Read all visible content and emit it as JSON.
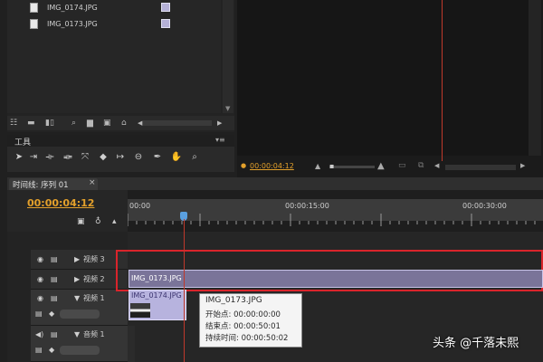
{
  "project": {
    "files": [
      {
        "name": "IMG_0174.JPG",
        "icon": "image-file-icon"
      },
      {
        "name": "IMG_0173.JPG",
        "icon": "image-file-icon"
      }
    ],
    "swatch_color": "#b5b1d7",
    "bottom_icons": [
      "list-view-icon",
      "icon-view-icon",
      "zoom-icon",
      "search-icon",
      "folder-icon",
      "new-item-icon",
      "delete-icon"
    ]
  },
  "tools": {
    "title": "工具",
    "items": [
      "selection-tool-icon",
      "track-select-icon",
      "ripple-edit-icon",
      "rolling-edit-icon",
      "rate-stretch-icon",
      "razor-icon",
      "slip-icon",
      "slide-icon",
      "pen-icon",
      "hand-icon",
      "zoom-tool-icon"
    ]
  },
  "monitor": {
    "timecode": "00:00:04:12"
  },
  "timeline": {
    "tab_label": "时间线: 序列 01",
    "tab_close": "×",
    "timecode": "00:00:04:12",
    "ruler_labels": [
      "00:00",
      "00:00:15:00",
      "00:00:30:00"
    ],
    "tracks": [
      {
        "label": "视频 3"
      },
      {
        "label": "视频 2"
      },
      {
        "label": "视频 1"
      },
      {
        "label": "音频 1"
      }
    ],
    "clips": {
      "v2": "IMG_0173.JPG",
      "v1": "IMG_0174.JPG"
    },
    "accent_color": "#d9242b",
    "playhead_color": "#c0392b"
  },
  "tooltip": {
    "name": "IMG_0173.JPG",
    "start": "开始点: 00:00:00:00",
    "end": "结束点: 00:00:50:01",
    "duration": "持续时间: 00:00:50:02"
  },
  "watermark": "头条 @千落未熙"
}
